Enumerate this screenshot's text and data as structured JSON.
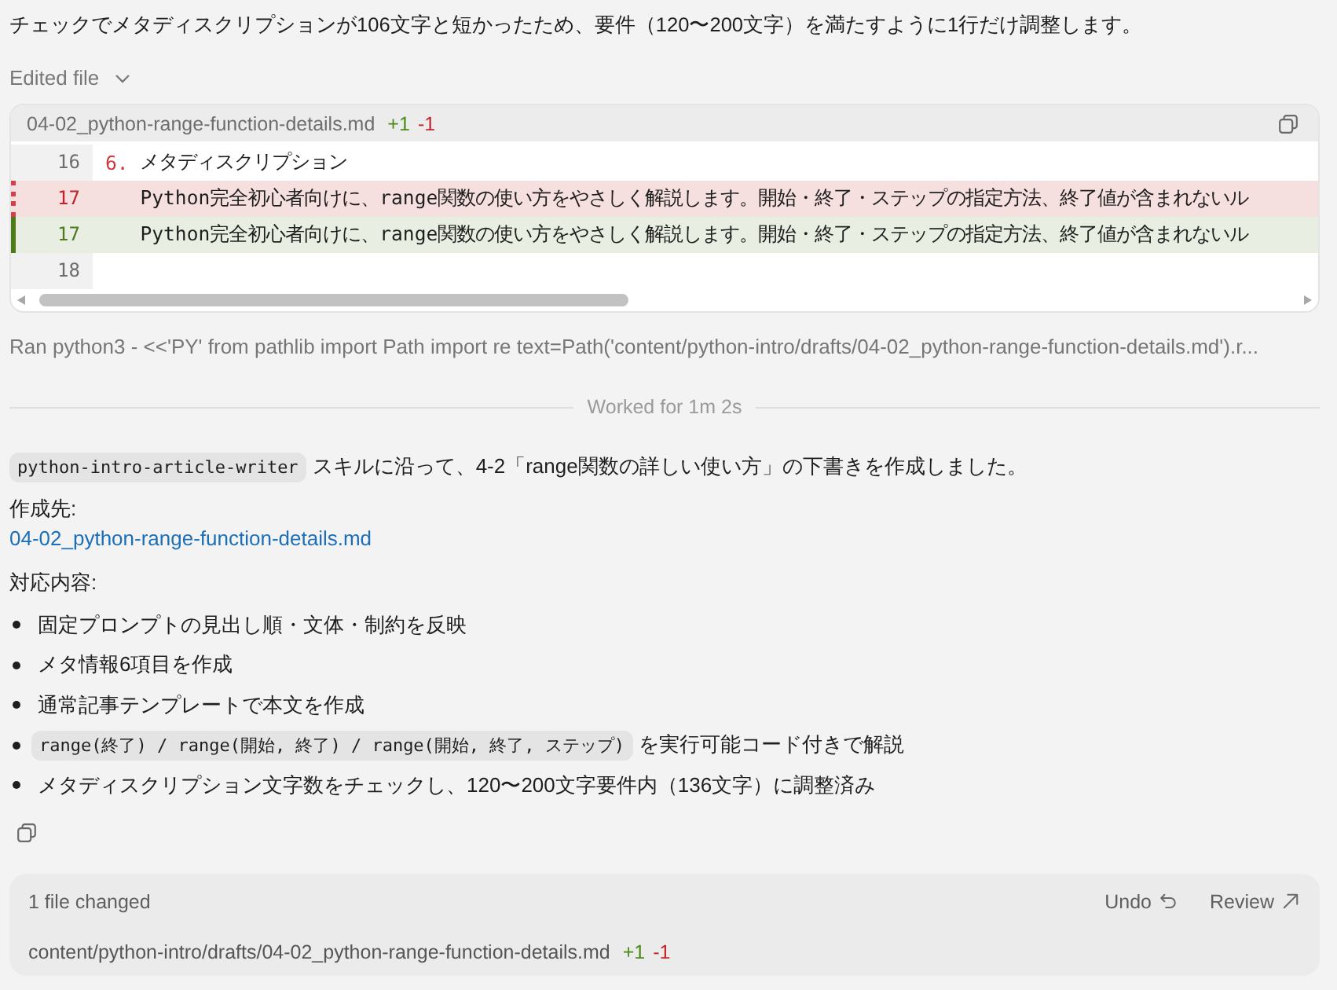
{
  "message": "チェックでメタディスクリプションが106文字と短かったため、要件（120〜200文字）を満たすように1行だけ調整します。",
  "edited_file": {
    "label": "Edited file"
  },
  "diff": {
    "filename": "04-02_python-range-function-details.md",
    "added": "+1",
    "removed": "-1",
    "lines": [
      {
        "kind": "context",
        "number": "16",
        "marker": "6.",
        "text": "メタディスクリプション"
      },
      {
        "kind": "removed",
        "number": "17",
        "text": "   Python完全初心者向けに、range関数の使い方をやさしく解説します。開始・終了・ステップの指定方法、終了値が含まれないル"
      },
      {
        "kind": "added",
        "number": "17",
        "text": "   Python完全初心者向けに、range関数の使い方をやさしく解説します。開始・終了・ステップの指定方法、終了値が含まれないル"
      },
      {
        "kind": "context",
        "number": "18"
      }
    ]
  },
  "command": "Ran python3 - <<'PY' from pathlib import Path import re text=Path('content/python-intro/drafts/04-02_python-range-function-details.md').r...",
  "worked": "Worked for 1m 2s",
  "summary": {
    "code": "python-intro-article-writer",
    "text": "スキルに沿って、4-2「range関数の詳しい使い方」の下書きを作成しました。"
  },
  "output": {
    "label": "作成先:",
    "link": "04-02_python-range-function-details.md"
  },
  "contents": {
    "label": "対応内容:",
    "items": [
      {
        "kind": "text",
        "text": "固定プロンプトの見出し順・文体・制約を反映"
      },
      {
        "kind": "text",
        "text": "メタ情報6項目を作成"
      },
      {
        "kind": "text",
        "text": "通常記事テンプレートで本文を作成"
      },
      {
        "kind": "code",
        "code": "range(終了) / range(開始, 終了) / range(開始, 終了, ステップ)",
        "text": "を実行可能コード付きで解説"
      },
      {
        "kind": "text",
        "text": "メタディスクリプション文字数をチェックし、120〜200文字要件内（136文字）に調整済み"
      }
    ]
  },
  "changes": {
    "title": "1 file changed",
    "undo": "Undo",
    "review": "Review",
    "path": "content/python-intro/drafts/04-02_python-range-function-details.md",
    "added": "+1",
    "removed": "-1"
  }
}
